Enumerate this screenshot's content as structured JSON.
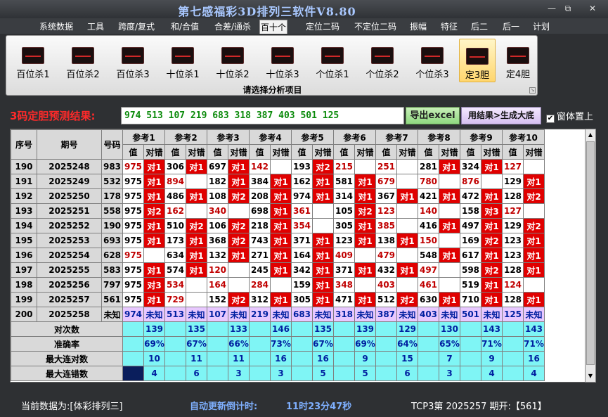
{
  "window": {
    "title": "第七感福彩3D排列三软件V8.80",
    "minimize": "—",
    "restore": "⧉",
    "close": "✕"
  },
  "menu": {
    "items": [
      "系统数据",
      "工具",
      "跨度/复式",
      "和/合值",
      "合差/通杀",
      "百十个",
      "定位二码",
      "不定位二码",
      "振幅",
      "特征",
      "后二",
      "后一",
      "计划"
    ],
    "active_index": 5
  },
  "ribbon": {
    "buttons": [
      "百位杀1",
      "百位杀2",
      "百位杀3",
      "十位杀1",
      "十位杀2",
      "十位杀3",
      "个位杀1",
      "个位杀2",
      "个位杀3",
      "定3胆",
      "定4胆"
    ],
    "selected_index": 9,
    "caption": "请选择分析项目",
    "icon": "chart-icon"
  },
  "prediction": {
    "label": "3码定胆预测结果:",
    "value": "974 513 107 219 683 318 387 403 501 125",
    "excel_button": "导出excel",
    "generate_button": "用结果>生成大底",
    "on_top_label": "窗体置上",
    "on_top_checked": "✔"
  },
  "table": {
    "header_fixed": [
      "序号",
      "期号",
      "号码"
    ],
    "ref_groups": [
      "参考1",
      "参考2",
      "参考3",
      "参考4",
      "参考5",
      "参考6",
      "参考7",
      "参考8",
      "参考9",
      "参考10"
    ],
    "sub_headers": [
      "值",
      "对错"
    ],
    "rows": [
      {
        "seq": "190",
        "period": "2025248",
        "num": "983",
        "cells": [
          [
            "975",
            1,
            "对1"
          ],
          [
            "306",
            0,
            "对1"
          ],
          [
            "697",
            0,
            "对1"
          ],
          [
            "142",
            1,
            ""
          ],
          [
            "193",
            0,
            "对2"
          ],
          [
            "215",
            1,
            ""
          ],
          [
            "251",
            1,
            ""
          ],
          [
            "281",
            0,
            "对1"
          ],
          [
            "324",
            0,
            "对1"
          ],
          [
            "127",
            1,
            ""
          ]
        ]
      },
      {
        "seq": "191",
        "period": "2025249",
        "num": "532",
        "cells": [
          [
            "975",
            0,
            "对1"
          ],
          [
            "894",
            1,
            ""
          ],
          [
            "182",
            0,
            "对1"
          ],
          [
            "384",
            0,
            "对1"
          ],
          [
            "162",
            0,
            "对1"
          ],
          [
            "581",
            0,
            "对1"
          ],
          [
            "679",
            1,
            ""
          ],
          [
            "780",
            1,
            ""
          ],
          [
            "876",
            1,
            ""
          ],
          [
            "129",
            0,
            "对1"
          ]
        ]
      },
      {
        "seq": "192",
        "period": "2025250",
        "num": "178",
        "cells": [
          [
            "975",
            0,
            "对1"
          ],
          [
            "486",
            0,
            "对1"
          ],
          [
            "108",
            0,
            "对2"
          ],
          [
            "208",
            0,
            "对1"
          ],
          [
            "974",
            0,
            "对1"
          ],
          [
            "314",
            0,
            "对1"
          ],
          [
            "367",
            0,
            "对1"
          ],
          [
            "421",
            0,
            "对1"
          ],
          [
            "472",
            0,
            "对1"
          ],
          [
            "128",
            0,
            "对2"
          ]
        ]
      },
      {
        "seq": "193",
        "period": "2025251",
        "num": "558",
        "cells": [
          [
            "975",
            0,
            "对2"
          ],
          [
            "162",
            1,
            ""
          ],
          [
            "340",
            1,
            ""
          ],
          [
            "698",
            0,
            "对1"
          ],
          [
            "361",
            1,
            ""
          ],
          [
            "105",
            0,
            "对2"
          ],
          [
            "123",
            1,
            ""
          ],
          [
            "140",
            1,
            ""
          ],
          [
            "158",
            0,
            "对3"
          ],
          [
            "127",
            1,
            ""
          ]
        ]
      },
      {
        "seq": "194",
        "period": "2025252",
        "num": "190",
        "cells": [
          [
            "975",
            0,
            "对1"
          ],
          [
            "510",
            0,
            "对2"
          ],
          [
            "106",
            0,
            "对2"
          ],
          [
            "218",
            0,
            "对1"
          ],
          [
            "354",
            1,
            ""
          ],
          [
            "305",
            0,
            "对1"
          ],
          [
            "385",
            1,
            ""
          ],
          [
            "416",
            0,
            "对1"
          ],
          [
            "497",
            0,
            "对1"
          ],
          [
            "129",
            0,
            "对2"
          ]
        ]
      },
      {
        "seq": "195",
        "period": "2025253",
        "num": "693",
        "cells": [
          [
            "975",
            0,
            "对1"
          ],
          [
            "173",
            0,
            "对1"
          ],
          [
            "368",
            0,
            "对2"
          ],
          [
            "743",
            0,
            "对1"
          ],
          [
            "371",
            0,
            "对1"
          ],
          [
            "123",
            0,
            "对1"
          ],
          [
            "138",
            0,
            "对1"
          ],
          [
            "150",
            1,
            ""
          ],
          [
            "169",
            0,
            "对2"
          ],
          [
            "123",
            0,
            "对1"
          ]
        ]
      },
      {
        "seq": "196",
        "period": "2025254",
        "num": "628",
        "cells": [
          [
            "975",
            1,
            ""
          ],
          [
            "634",
            0,
            "对1"
          ],
          [
            "132",
            0,
            "对1"
          ],
          [
            "271",
            0,
            "对1"
          ],
          [
            "164",
            0,
            "对1"
          ],
          [
            "409",
            1,
            ""
          ],
          [
            "479",
            1,
            ""
          ],
          [
            "548",
            0,
            "对1"
          ],
          [
            "617",
            0,
            "对1"
          ],
          [
            "123",
            0,
            "对1"
          ]
        ]
      },
      {
        "seq": "197",
        "period": "2025255",
        "num": "583",
        "cells": [
          [
            "975",
            0,
            "对1"
          ],
          [
            "574",
            0,
            "对1"
          ],
          [
            "120",
            1,
            ""
          ],
          [
            "245",
            0,
            "对1"
          ],
          [
            "342",
            0,
            "对1"
          ],
          [
            "371",
            0,
            "对1"
          ],
          [
            "432",
            0,
            "对1"
          ],
          [
            "497",
            1,
            ""
          ],
          [
            "598",
            0,
            "对2"
          ],
          [
            "128",
            0,
            "对1"
          ]
        ]
      },
      {
        "seq": "198",
        "period": "2025256",
        "num": "797",
        "cells": [
          [
            "975",
            0,
            "对3"
          ],
          [
            "534",
            1,
            ""
          ],
          [
            "164",
            1,
            ""
          ],
          [
            "284",
            1,
            ""
          ],
          [
            "159",
            0,
            "对1"
          ],
          [
            "348",
            1,
            ""
          ],
          [
            "403",
            1,
            ""
          ],
          [
            "461",
            1,
            ""
          ],
          [
            "519",
            0,
            "对1"
          ],
          [
            "124",
            1,
            ""
          ]
        ]
      },
      {
        "seq": "199",
        "period": "2025257",
        "num": "561",
        "cells": [
          [
            "975",
            0,
            "对1"
          ],
          [
            "729",
            1,
            ""
          ],
          [
            "152",
            0,
            "对2"
          ],
          [
            "312",
            0,
            "对1"
          ],
          [
            "305",
            0,
            "对1"
          ],
          [
            "471",
            0,
            "对1"
          ],
          [
            "512",
            0,
            "对2"
          ],
          [
            "630",
            0,
            "对1"
          ],
          [
            "710",
            0,
            "对1"
          ],
          [
            "128",
            0,
            "对1"
          ]
        ]
      }
    ],
    "pending": {
      "seq": "200",
      "period": "2025258",
      "num": "未知",
      "values": [
        "974",
        "513",
        "107",
        "219",
        "683",
        "318",
        "387",
        "403",
        "501",
        "125"
      ],
      "status": "未知"
    },
    "stats": [
      {
        "label": "对次数",
        "values": [
          "139",
          "135",
          "133",
          "146",
          "135",
          "139",
          "129",
          "130",
          "143",
          "143"
        ]
      },
      {
        "label": "准确率",
        "values": [
          "69%",
          "67%",
          "66%",
          "73%",
          "67%",
          "69%",
          "64%",
          "65%",
          "71%",
          "71%"
        ]
      },
      {
        "label": "最大连对数",
        "values": [
          "10",
          "11",
          "11",
          "16",
          "16",
          "9",
          "15",
          "7",
          "9",
          "16"
        ]
      },
      {
        "label": "最大连错数",
        "values": [
          "4",
          "6",
          "3",
          "3",
          "5",
          "5",
          "6",
          "3",
          "4",
          "4"
        ]
      }
    ]
  },
  "status": {
    "data_label": "当前数据为:[体彩排列三]",
    "countdown_label": "自动更新倒计时:",
    "countdown": "11时23分47秒",
    "draw": "TCP3第 2025257 期开:【561】"
  },
  "colors": {
    "hit": "#e00000",
    "stat_bg": "#7ff5f5",
    "pending_bg": "#e8c8ff",
    "miss_text": "#c00000"
  }
}
